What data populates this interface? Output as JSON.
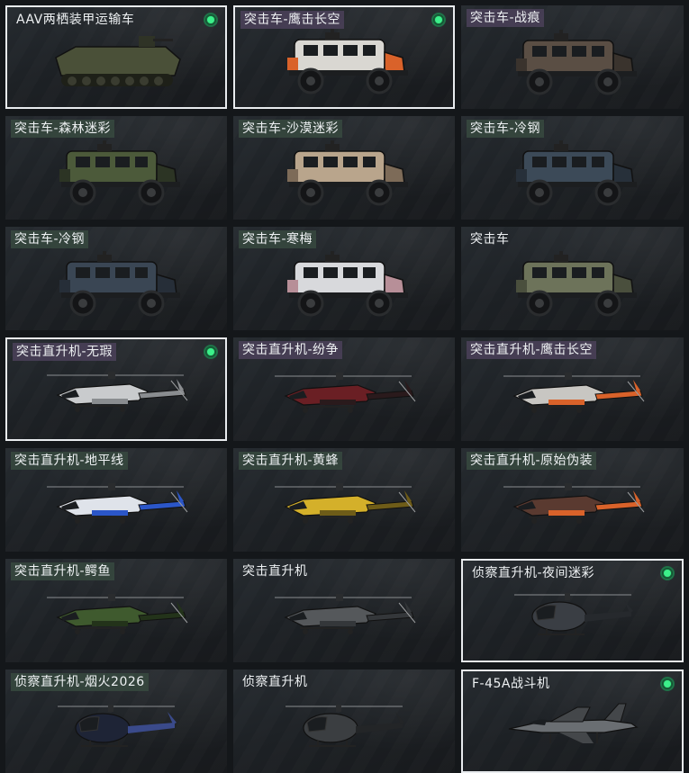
{
  "tiles": [
    {
      "name": "AAV两栖装甲运输车",
      "type": "amphibious",
      "tag": "plain",
      "equipped": true,
      "badge": true,
      "colors": [
        "#4a5038",
        "#2f3326"
      ]
    },
    {
      "name": "突击车-鹰击长空",
      "type": "truck",
      "tag": "purple",
      "equipped": true,
      "badge": true,
      "colors": [
        "#d9d7d2",
        "#d9622a"
      ]
    },
    {
      "name": "突击车-战痕",
      "type": "truck",
      "tag": "purple",
      "equipped": false,
      "badge": false,
      "colors": [
        "#5a4e44",
        "#3a332d"
      ]
    },
    {
      "name": "突击车-森林迷彩",
      "type": "truck",
      "tag": "green",
      "equipped": false,
      "badge": false,
      "colors": [
        "#4c5a3a",
        "#2c3424"
      ]
    },
    {
      "name": "突击车-沙漠迷彩",
      "type": "truck",
      "tag": "green",
      "equipped": false,
      "badge": false,
      "colors": [
        "#b9a58c",
        "#7d6b58"
      ]
    },
    {
      "name": "突击车-冷钢",
      "type": "truck",
      "tag": "green",
      "equipped": false,
      "badge": false,
      "colors": [
        "#3c4a58",
        "#27303a"
      ]
    },
    {
      "name": "突击车-冷钢",
      "type": "truck",
      "tag": "green",
      "equipped": false,
      "badge": false,
      "colors": [
        "#3a4654",
        "#262e38"
      ]
    },
    {
      "name": "突击车-寒梅",
      "type": "truck",
      "tag": "green",
      "equipped": false,
      "badge": false,
      "colors": [
        "#d8d9dc",
        "#b78f98"
      ]
    },
    {
      "name": "突击车",
      "type": "truck",
      "tag": "plain",
      "equipped": false,
      "badge": false,
      "colors": [
        "#6d735a",
        "#4a4f3d"
      ]
    },
    {
      "name": "突击直升机-无瑕",
      "type": "heli",
      "tag": "purple",
      "equipped": true,
      "badge": true,
      "colors": [
        "#c9cbcd",
        "#8a8d90"
      ]
    },
    {
      "name": "突击直升机-纷争",
      "type": "heli",
      "tag": "purple",
      "equipped": false,
      "badge": false,
      "colors": [
        "#6a1f24",
        "#2a1a1c"
      ]
    },
    {
      "name": "突击直升机-鹰击长空",
      "type": "heli",
      "tag": "purple",
      "equipped": false,
      "badge": false,
      "colors": [
        "#c8c6c2",
        "#d9622a"
      ]
    },
    {
      "name": "突击直升机-地平线",
      "type": "heli",
      "tag": "green",
      "equipped": false,
      "badge": false,
      "colors": [
        "#dfe3ea",
        "#2b56c8"
      ]
    },
    {
      "name": "突击直升机-黄蜂",
      "type": "heli",
      "tag": "green",
      "equipped": false,
      "badge": false,
      "colors": [
        "#d4b02a",
        "#6e5c18"
      ]
    },
    {
      "name": "突击直升机-原始伪装",
      "type": "heli",
      "tag": "green",
      "equipped": false,
      "badge": false,
      "colors": [
        "#5a3a30",
        "#d9622a"
      ]
    },
    {
      "name": "突击直升机-鳄鱼",
      "type": "heli",
      "tag": "green",
      "equipped": false,
      "badge": false,
      "colors": [
        "#3f5a2e",
        "#23331a"
      ]
    },
    {
      "name": "突击直升机",
      "type": "heli",
      "tag": "plain",
      "equipped": false,
      "badge": false,
      "colors": [
        "#55585b",
        "#34373a"
      ]
    },
    {
      "name": "侦察直升机-夜间迷彩",
      "type": "scout",
      "tag": "plain",
      "equipped": true,
      "badge": true,
      "colors": [
        "#3a3e44",
        "#26292d"
      ]
    },
    {
      "name": "侦察直升机-烟火2026",
      "type": "scout",
      "tag": "green",
      "equipped": false,
      "badge": false,
      "colors": [
        "#1e2436",
        "#3a4a8a"
      ]
    },
    {
      "name": "侦察直升机",
      "type": "scout",
      "tag": "plain",
      "equipped": false,
      "badge": false,
      "colors": [
        "#3b3e41",
        "#232527"
      ]
    },
    {
      "name": "F-45A战斗机",
      "type": "jet",
      "tag": "plain",
      "equipped": true,
      "badge": true,
      "colors": [
        "#6a6e72",
        "#44474a"
      ]
    }
  ]
}
